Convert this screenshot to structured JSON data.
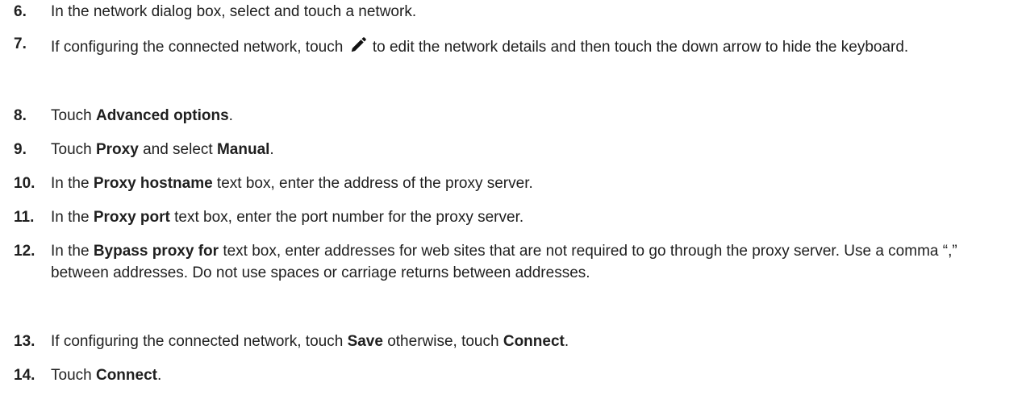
{
  "steps": [
    {
      "number": "6.",
      "parts": [
        {
          "text": "In the network dialog box, select and touch a network."
        }
      ]
    },
    {
      "number": "7.",
      "parts": [
        {
          "text": "If configuring the connected network, touch "
        },
        {
          "icon": "pencil-icon"
        },
        {
          "text": " to edit the network details and then touch the down arrow to hide the keyboard."
        }
      ]
    },
    {
      "number": "8.",
      "parts": [
        {
          "text": "Touch "
        },
        {
          "text": "Advanced options",
          "bold": true
        },
        {
          "text": "."
        }
      ]
    },
    {
      "number": "9.",
      "parts": [
        {
          "text": "Touch "
        },
        {
          "text": "Proxy",
          "bold": true
        },
        {
          "text": " and select "
        },
        {
          "text": "Manual",
          "bold": true
        },
        {
          "text": "."
        }
      ]
    },
    {
      "number": "10.",
      "parts": [
        {
          "text": "In the "
        },
        {
          "text": "Proxy hostname",
          "bold": true
        },
        {
          "text": " text box, enter the address of the proxy server."
        }
      ]
    },
    {
      "number": "11.",
      "parts": [
        {
          "text": "In the "
        },
        {
          "text": "Proxy port",
          "bold": true
        },
        {
          "text": " text box, enter the port number for the proxy server."
        }
      ]
    },
    {
      "number": "12.",
      "parts": [
        {
          "text": "In the "
        },
        {
          "text": "Bypass proxy for",
          "bold": true
        },
        {
          "text": " text box, enter addresses for web sites that are not required to go through the proxy server. Use a comma “,” between addresses. Do not use spaces or carriage returns between addresses."
        }
      ]
    },
    {
      "number": "13.",
      "parts": [
        {
          "text": "If configuring the connected network, touch "
        },
        {
          "text": "Save",
          "bold": true
        },
        {
          "text": " otherwise, touch "
        },
        {
          "text": "Connect",
          "bold": true
        },
        {
          "text": "."
        }
      ]
    },
    {
      "number": "14.",
      "parts": [
        {
          "text": "Touch "
        },
        {
          "text": "Connect",
          "bold": true
        },
        {
          "text": "."
        }
      ]
    }
  ]
}
